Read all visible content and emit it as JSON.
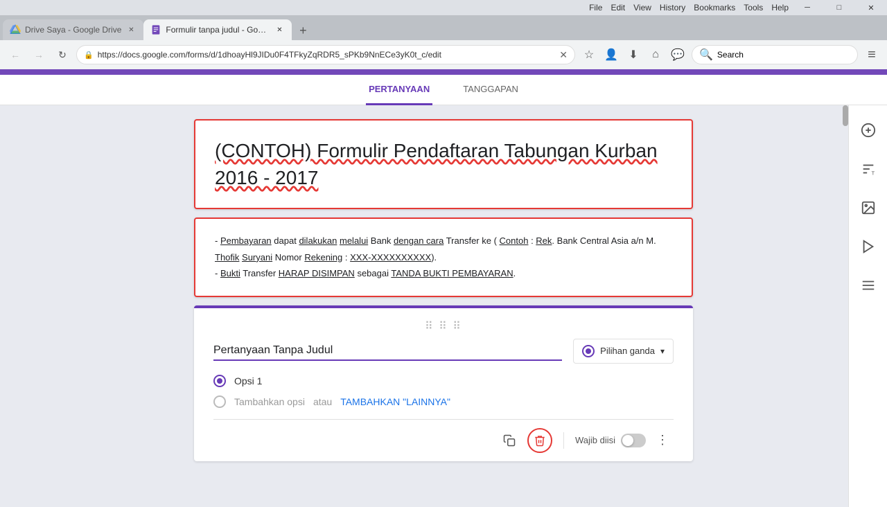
{
  "window": {
    "title": "Formulir tanpa judul - Google ...",
    "menubar": [
      "File",
      "Edit",
      "View",
      "History",
      "Bookmarks",
      "Tools",
      "Help"
    ]
  },
  "tabs": [
    {
      "id": "tab-drive",
      "favicon": "drive",
      "title": "Drive Saya - Google Drive",
      "active": false
    },
    {
      "id": "tab-forms",
      "favicon": "forms",
      "title": "Formulir tanpa judul - Google ...",
      "active": true
    }
  ],
  "addressbar": {
    "url": "https://docs.google.com/forms/d/1dhoayHl9JIDu0F4TFkyZqRDR5_sPKb9NnECe3yK0t_c/edit",
    "search_placeholder": "Search",
    "search_value": "Search"
  },
  "forms": {
    "tabs": [
      {
        "id": "pertanyaan",
        "label": "PERTANYAAN",
        "active": true
      },
      {
        "id": "tanggapan",
        "label": "TANGGAPAN",
        "active": false
      }
    ],
    "title_card": {
      "title": "(CONTOH) Formulir Pendaftaran Tabungan Kurban 2016 - 2017"
    },
    "description_card": {
      "line1": "- Pembayaran dapat dilakukan melalui Bank dengan cara Transfer ke ( Contoh : Rek. Bank Central Asia a/n M. Thofik Suryani Nomor Rekening : XXX-XXXXXXXXXX).",
      "line2": "- Bukti Transfer HARAP DISIMPAN sebagai TANDA BUKTI PEMBAYARAN."
    },
    "question_card": {
      "question_text": "Pertanyaan Tanpa Judul",
      "question_type": "Pilihan ganda",
      "option1": "Opsi 1",
      "add_option_text": "Tambahkan opsi",
      "add_option_or": "atau",
      "add_other_label": "TAMBAHKAN \"LAINNYA\"",
      "wajib_label": "Wajib diisi",
      "drag_handle": "⠿⠿⠿"
    },
    "sidebar": {
      "buttons": [
        {
          "icon": "+",
          "label": "add-question-icon"
        },
        {
          "icon": "T",
          "label": "add-title-icon"
        },
        {
          "icon": "🖼",
          "label": "add-image-icon"
        },
        {
          "icon": "▶",
          "label": "add-video-icon"
        },
        {
          "icon": "☰",
          "label": "add-section-icon"
        }
      ]
    }
  },
  "colors": {
    "purple": "#673ab7",
    "red": "#e53935",
    "blue": "#1a73e8",
    "header_purple": "#7248b9"
  }
}
